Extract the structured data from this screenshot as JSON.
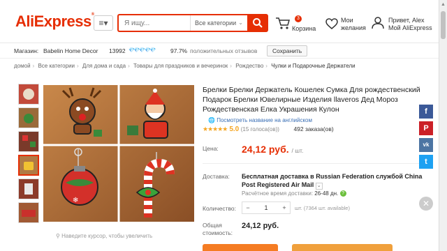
{
  "brand": {
    "logo_text": "AliExpress",
    "accent": "#e62e04"
  },
  "header": {
    "menu_icon": "≡▾",
    "search_placeholder": "Я ищу...",
    "category_select": "Все категории",
    "cart_count": "3",
    "cart_label": "Корзина",
    "wishlist_line1": "Мои",
    "wishlist_line2": "желания",
    "user_line1": "Привет, Alex",
    "user_line2": "Мой AliExpress"
  },
  "store": {
    "label": "Магазин:",
    "name": "Babelin Home Decor",
    "score": "13992",
    "diamonds": "💎💎💎💎💎",
    "positive": "97.7%",
    "positive_label": "положительных отзывов",
    "save_button": "Сохранить"
  },
  "breadcrumbs": [
    "домой",
    "Все категории",
    "Для дома и сада",
    "Товары для праздников и вечеринок",
    "Рождество",
    "Чулки и Подарочные Держатели"
  ],
  "gallery": {
    "zoom_hint": "Наведите курсор, чтобы увеличить"
  },
  "product": {
    "title": "Брелки Брелки Держатель Кошелек Сумка Для рождественский Подарок Брелки Ювелирные Изделия llaveros Дед Мороз Рождественская Елка Украшения Кулон",
    "translate_link": "Посмотреть название на английском",
    "stars": "★★★★★",
    "rating": "5.0",
    "votes": "(15 голоса(ов))",
    "orders": "492 заказа(ов)",
    "price_label": "Цена:",
    "price": "24,12 руб.",
    "price_unit": "/ шт.",
    "shipping_label": "Доставка:",
    "shipping_text": "Бесплатная доставка в Russian Federation службой China Post Registered Air Mail",
    "eta_label": "Расчётное время доставки:",
    "eta_value": "26-48 дн.",
    "eta_help": "?",
    "qty_label": "Количество:",
    "qty_minus": "−",
    "qty_value": "1",
    "qty_plus": "+",
    "availability": "шт. (7364 шт. available)",
    "total_label_1": "Общая",
    "total_label_2": "стоимость:",
    "total": "24,12 руб."
  },
  "share": {
    "facebook": "f",
    "pinterest": "P",
    "vk": "vk",
    "twitter": "t",
    "close": "✕"
  }
}
